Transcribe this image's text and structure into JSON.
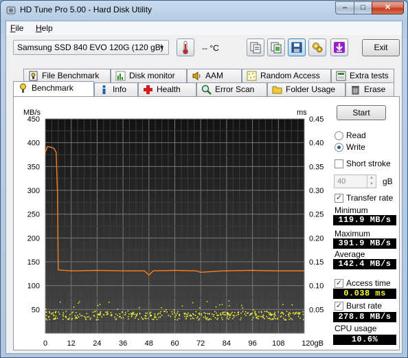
{
  "window": {
    "title": "HD Tune Pro 5.00 - Hard Disk Utility",
    "min": "–",
    "max": "□",
    "close": "✕"
  },
  "menu": [
    {
      "accel": "F",
      "rest": "ile"
    },
    {
      "accel": "H",
      "rest": "elp"
    }
  ],
  "toolbar": {
    "drive": "Samsung SSD 840 EVO 120G (120 gB)",
    "temperature": "-- °C",
    "exit_label": "Exit",
    "icons": [
      "thermometer-icon",
      "copy-info-icon",
      "copy-screenshot-icon",
      "save-icon",
      "options-icon",
      "download-icon"
    ]
  },
  "tabs_top": [
    {
      "label": "File Benchmark",
      "icon": "file-benchmark-icon"
    },
    {
      "label": "Disk monitor",
      "icon": "disk-monitor-icon"
    },
    {
      "label": "AAM",
      "icon": "speaker-icon"
    },
    {
      "label": "Random Access",
      "icon": "random-access-icon"
    },
    {
      "label": "Extra tests",
      "icon": "extra-tests-icon"
    }
  ],
  "tabs_bottom": [
    {
      "label": "Benchmark",
      "icon": "benchmark-icon",
      "selected": true
    },
    {
      "label": "Info",
      "icon": "info-icon"
    },
    {
      "label": "Health",
      "icon": "health-icon"
    },
    {
      "label": "Error Scan",
      "icon": "error-scan-icon"
    },
    {
      "label": "Folder Usage",
      "icon": "folder-icon"
    },
    {
      "label": "Erase",
      "icon": "trash-icon"
    }
  ],
  "controls": {
    "start_label": "Start",
    "read_label": "Read",
    "write_label": "Write",
    "mode": "write",
    "short_stroke_label": "Short stroke",
    "short_stroke_checked": false,
    "short_stroke_value": "40",
    "short_stroke_unit": "gB",
    "transfer_rate_label": "Transfer rate",
    "transfer_rate_checked": true,
    "minimum_label": "Minimum",
    "minimum_value": "119.9 MB/s",
    "maximum_label": "Maximum",
    "maximum_value": "391.9 MB/s",
    "average_label": "Average",
    "average_value": "142.4 MB/s",
    "access_time_label": "Access time",
    "access_time_checked": true,
    "access_time_value": "0.038 ms",
    "burst_rate_label": "Burst rate",
    "burst_rate_checked": true,
    "burst_rate_value": "278.8 MB/s",
    "cpu_usage_label": "CPU usage",
    "cpu_usage_value": "10.6%"
  },
  "chart_data": {
    "type": "line",
    "left_unit": "MB/s",
    "right_unit": "ms",
    "x_ticks": [
      "0",
      "12",
      "24",
      "36",
      "48",
      "60",
      "72",
      "84",
      "96",
      "108",
      "120gB"
    ],
    "y_ticks_left": [
      "450",
      "400",
      "350",
      "300",
      "250",
      "200",
      "150",
      "100",
      "50"
    ],
    "y_ticks_right": [
      "0.45",
      "0.40",
      "0.35",
      "0.30",
      "0.25",
      "0.20",
      "0.15",
      "0.10",
      "0.05"
    ],
    "xlim": [
      0,
      120
    ],
    "ylim_left": [
      0,
      450
    ],
    "ylim_right": [
      0,
      0.45
    ],
    "grid": true,
    "transfer_rate_color": "#ff7f1e",
    "access_time_color": "#ffff2e",
    "series": [
      {
        "name": "Transfer rate",
        "x": [
          0,
          1,
          2,
          3,
          4,
          5,
          5.6,
          6,
          12,
          24,
          36,
          46,
          48,
          50,
          60,
          70,
          72,
          82,
          96,
          108,
          120
        ],
        "y": [
          380,
          392,
          391,
          390,
          388,
          380,
          300,
          133,
          131,
          132,
          131,
          131,
          122,
          131,
          132,
          131,
          128,
          131,
          132,
          131,
          131
        ]
      },
      {
        "name": "Access time",
        "x_range": [
          0,
          120
        ],
        "y_band_ms": [
          0.025,
          0.06
        ],
        "y_typical_ms": 0.038
      }
    ]
  }
}
